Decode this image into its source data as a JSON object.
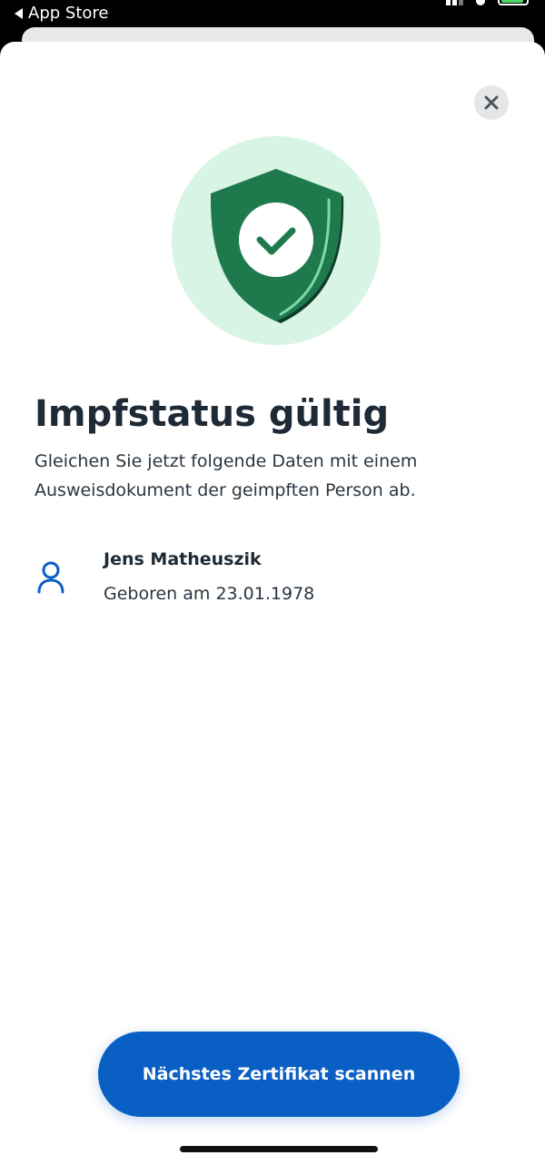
{
  "status_bar": {
    "back_app_label": "App Store"
  },
  "header": {
    "close_icon": "close-icon"
  },
  "status_illustration": {
    "icon": "shield-check-icon",
    "circle_color": "#d8f4e4",
    "shield_color": "#1e7a4d"
  },
  "result": {
    "title": "Impfstatus gültig",
    "instruction": "Gleichen Sie jetzt folgende Daten mit einem Ausweisdokument der geimpften Person ab."
  },
  "person": {
    "icon": "person-icon",
    "name": "Jens Matheuszik",
    "birth": "Geboren am 23.01.1978"
  },
  "actions": {
    "scan_next_label": "Nächstes Zertifikat scannen",
    "accent_color": "#0a5fc4"
  }
}
